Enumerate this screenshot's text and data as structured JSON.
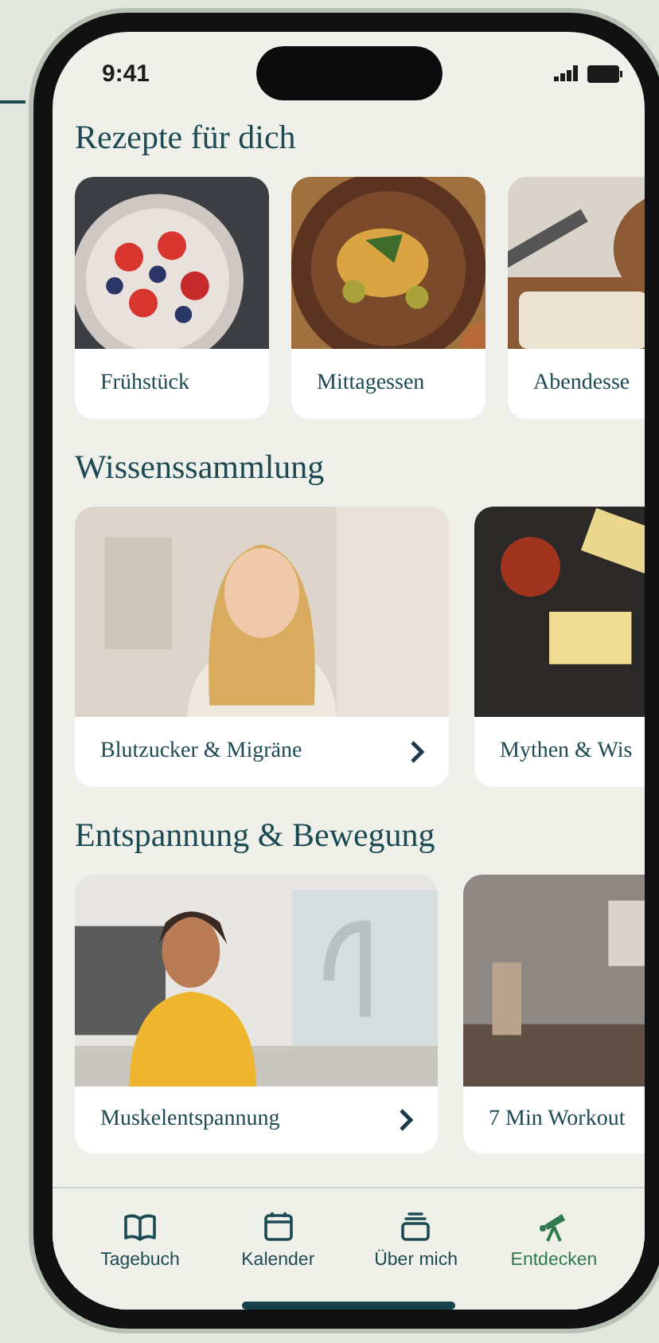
{
  "status_bar": {
    "time": "9:41"
  },
  "sections": [
    {
      "title": "Rezepte für dich",
      "kind": "tile",
      "cards": [
        {
          "label": "Frühstück",
          "arrow": false
        },
        {
          "label": "Mittagessen",
          "arrow": false
        },
        {
          "label": "Abendesse",
          "arrow": false
        }
      ]
    },
    {
      "title": "Wissenssammlung",
      "kind": "wide",
      "cards": [
        {
          "label": "Blutzucker & Migräne",
          "arrow": true
        },
        {
          "label": "Mythen & Wis",
          "arrow": false
        }
      ]
    },
    {
      "title": "Entspannung & Bewegung",
      "kind": "medium",
      "cards": [
        {
          "label": "Muskelentspannung",
          "arrow": true
        },
        {
          "label": "7 Min Workout",
          "arrow": false
        }
      ]
    }
  ],
  "tabs": [
    {
      "label": "Tagebuch",
      "selected": false
    },
    {
      "label": "Kalender",
      "selected": false
    },
    {
      "label": "Über mich",
      "selected": false
    },
    {
      "label": "Entdecken",
      "selected": true
    }
  ]
}
